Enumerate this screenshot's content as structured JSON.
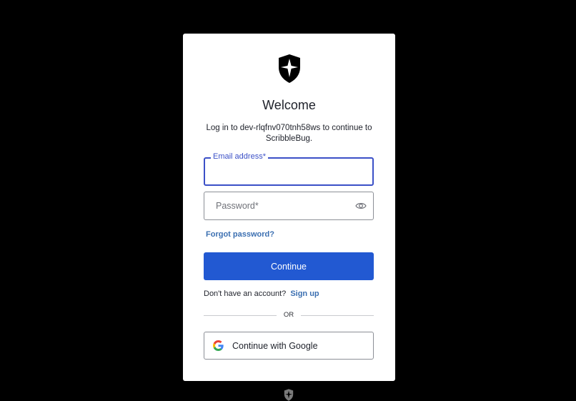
{
  "login": {
    "title": "Welcome",
    "subtitle": "Log in to dev-rlqfnv070tnh58ws to continue to ScribbleBug.",
    "email_label": "Email address*",
    "email_value": "",
    "password_placeholder": "Password*",
    "forgot_password": "Forgot password?",
    "continue_button": "Continue",
    "no_account_text": "Don't have an account?",
    "signup_link": "Sign up",
    "divider_text": "OR",
    "google_button": "Continue with Google"
  },
  "icons": {
    "brand_logo": "shield-star-icon",
    "password_toggle": "eye-icon",
    "google": "google-g-icon",
    "footer_logo": "shield-star-icon"
  },
  "colors": {
    "background": "#000000",
    "card": "#ffffff",
    "primary_button": "#2259d2",
    "focus_border": "#3b50c7",
    "link": "#3b6fb1"
  }
}
